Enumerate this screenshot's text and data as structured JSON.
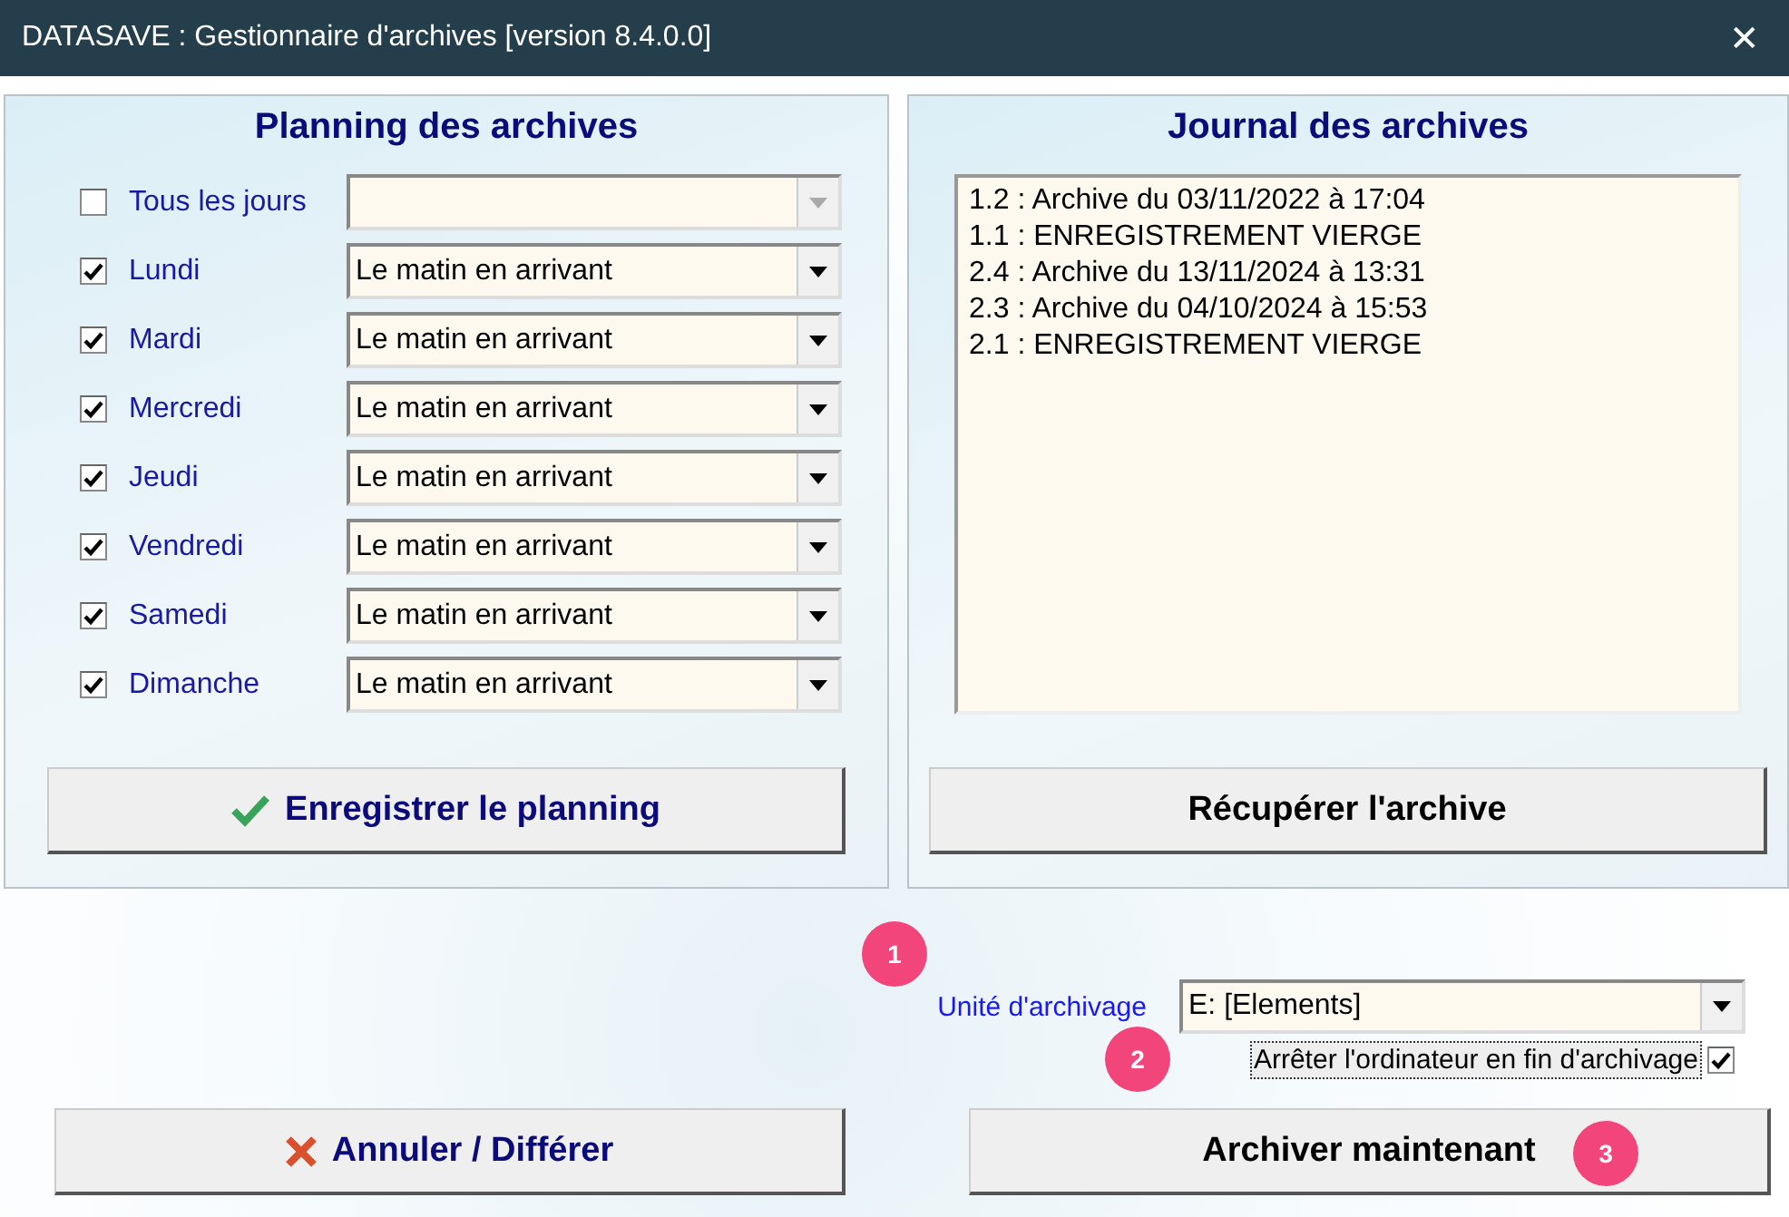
{
  "window": {
    "title": "DATASAVE : Gestionnaire d'archives [version 8.4.0.0]",
    "close": "✕"
  },
  "planning": {
    "title": "Planning des archives",
    "rows": [
      {
        "label": "Tous les jours",
        "checked": false,
        "value": "",
        "disabled": true
      },
      {
        "label": "Lundi",
        "checked": true,
        "value": "Le matin en arrivant",
        "disabled": false
      },
      {
        "label": "Mardi",
        "checked": true,
        "value": "Le matin en arrivant",
        "disabled": false
      },
      {
        "label": "Mercredi",
        "checked": true,
        "value": "Le matin en arrivant",
        "disabled": false
      },
      {
        "label": "Jeudi",
        "checked": true,
        "value": "Le matin en arrivant",
        "disabled": false
      },
      {
        "label": "Vendredi",
        "checked": true,
        "value": "Le matin en arrivant",
        "disabled": false
      },
      {
        "label": "Samedi",
        "checked": true,
        "value": "Le matin en arrivant",
        "disabled": false
      },
      {
        "label": "Dimanche",
        "checked": true,
        "value": "Le matin en arrivant",
        "disabled": false
      }
    ],
    "save_button": "Enregistrer le planning"
  },
  "journal": {
    "title": "Journal des archives",
    "entries": [
      "1.2 : Archive du 03/11/2022 à 17:04",
      "1.1 : ENREGISTREMENT VIERGE",
      "2.4 : Archive du 13/11/2024 à 13:31",
      "2.3 : Archive du 04/10/2024 à 15:53",
      "2.1 : ENREGISTREMENT VIERGE"
    ],
    "restore_button": "Récupérer l'archive"
  },
  "unit": {
    "label": "Unité d'archivage",
    "value": "E: [Elements]"
  },
  "shutdown": {
    "label": "Arrêter l'ordinateur en fin d'archivage",
    "checked": true
  },
  "cancel_button": "Annuler / Différer",
  "archive_button": "Archiver maintenant",
  "callouts": [
    "1",
    "2",
    "3"
  ]
}
